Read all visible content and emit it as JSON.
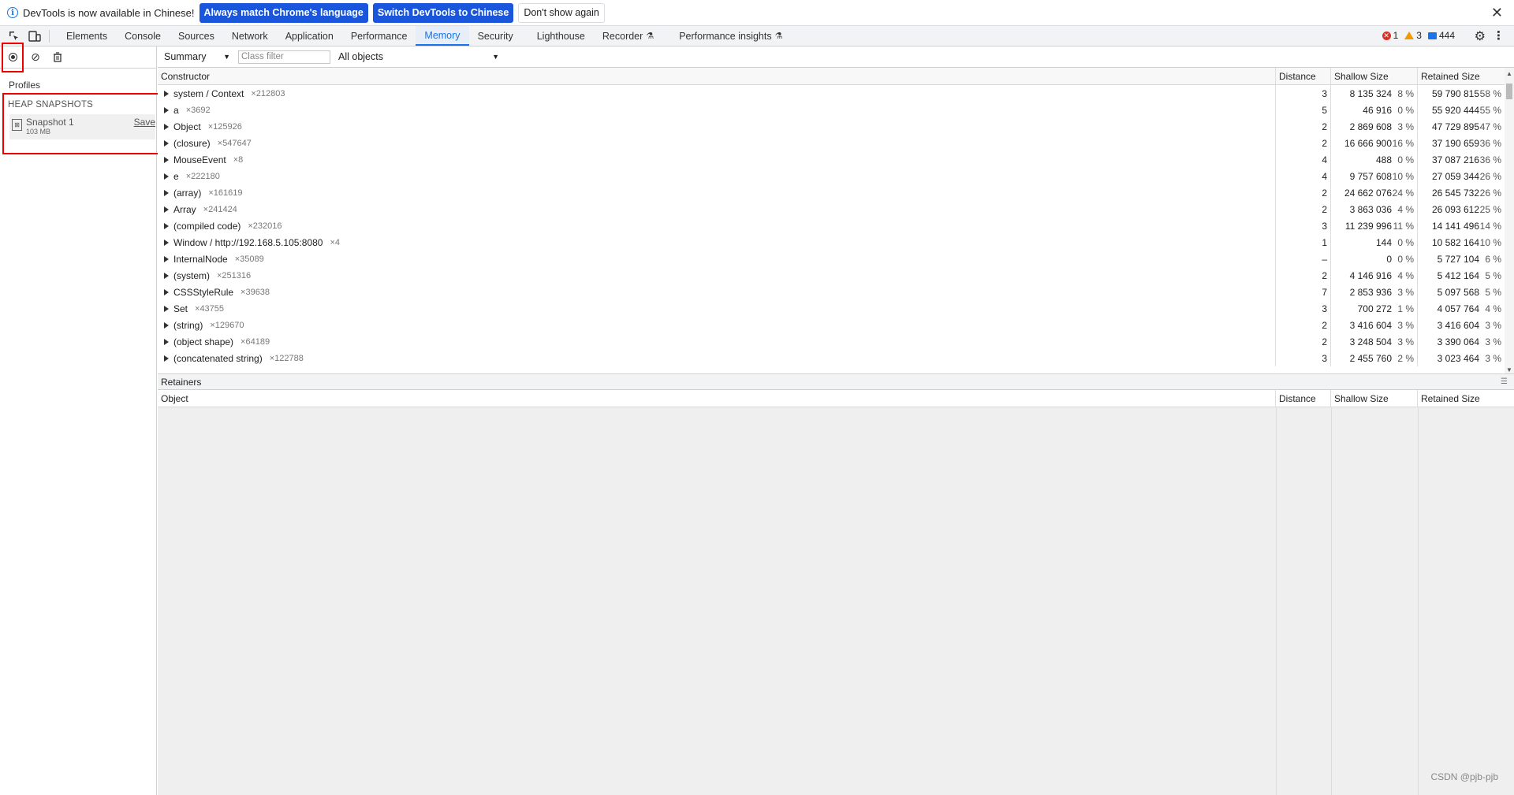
{
  "infobar": {
    "message": "DevTools is now available in Chinese!",
    "btn_match": "Always match Chrome's language",
    "btn_switch": "Switch DevTools to Chinese",
    "btn_dont_show": "Don't show again"
  },
  "tabs": {
    "elements": "Elements",
    "console": "Console",
    "sources": "Sources",
    "network": "Network",
    "application": "Application",
    "performance": "Performance",
    "memory": "Memory",
    "security": "Security",
    "lighthouse": "Lighthouse",
    "recorder": "Recorder",
    "perf_insights": "Performance insights"
  },
  "status": {
    "errors": "1",
    "warnings": "3",
    "messages": "444"
  },
  "sidebar": {
    "profiles_label": "Profiles",
    "heap_header": "HEAP SNAPSHOTS",
    "snapshot_name": "Snapshot 1",
    "snapshot_size": "103 MB",
    "save_label": "Save"
  },
  "toolbar": {
    "view": "Summary",
    "class_filter_placeholder": "Class filter",
    "filter": "All objects"
  },
  "grid": {
    "headers": {
      "constructor": "Constructor",
      "distance": "Distance",
      "shallow": "Shallow Size",
      "retained": "Retained Size"
    },
    "rows": [
      {
        "name": "system / Context",
        "count": "×212803",
        "distance": "3",
        "shallow": "8 135 324",
        "shallow_pct": "8 %",
        "retained": "59 790 815",
        "retained_pct": "58 %"
      },
      {
        "name": "a",
        "count": "×3692",
        "distance": "5",
        "shallow": "46 916",
        "shallow_pct": "0 %",
        "retained": "55 920 444",
        "retained_pct": "55 %"
      },
      {
        "name": "Object",
        "count": "×125926",
        "distance": "2",
        "shallow": "2 869 608",
        "shallow_pct": "3 %",
        "retained": "47 729 895",
        "retained_pct": "47 %"
      },
      {
        "name": "(closure)",
        "count": "×547647",
        "distance": "2",
        "shallow": "16 666 900",
        "shallow_pct": "16 %",
        "retained": "37 190 659",
        "retained_pct": "36 %"
      },
      {
        "name": "MouseEvent",
        "count": "×8",
        "distance": "4",
        "shallow": "488",
        "shallow_pct": "0 %",
        "retained": "37 087 216",
        "retained_pct": "36 %"
      },
      {
        "name": "e",
        "count": "×222180",
        "distance": "4",
        "shallow": "9 757 608",
        "shallow_pct": "10 %",
        "retained": "27 059 344",
        "retained_pct": "26 %"
      },
      {
        "name": "(array)",
        "count": "×161619",
        "distance": "2",
        "shallow": "24 662 076",
        "shallow_pct": "24 %",
        "retained": "26 545 732",
        "retained_pct": "26 %"
      },
      {
        "name": "Array",
        "count": "×241424",
        "distance": "2",
        "shallow": "3 863 036",
        "shallow_pct": "4 %",
        "retained": "26 093 612",
        "retained_pct": "25 %"
      },
      {
        "name": "(compiled code)",
        "count": "×232016",
        "distance": "3",
        "shallow": "11 239 996",
        "shallow_pct": "11 %",
        "retained": "14 141 496",
        "retained_pct": "14 %"
      },
      {
        "name": "Window / http://192.168.5.105:8080",
        "count": "×4",
        "distance": "1",
        "shallow": "144",
        "shallow_pct": "0 %",
        "retained": "10 582 164",
        "retained_pct": "10 %"
      },
      {
        "name": "InternalNode",
        "count": "×35089",
        "distance": "–",
        "shallow": "0",
        "shallow_pct": "0 %",
        "retained": "5 727 104",
        "retained_pct": "6 %"
      },
      {
        "name": "(system)",
        "count": "×251316",
        "distance": "2",
        "shallow": "4 146 916",
        "shallow_pct": "4 %",
        "retained": "5 412 164",
        "retained_pct": "5 %"
      },
      {
        "name": "CSSStyleRule",
        "count": "×39638",
        "distance": "7",
        "shallow": "2 853 936",
        "shallow_pct": "3 %",
        "retained": "5 097 568",
        "retained_pct": "5 %"
      },
      {
        "name": "Set",
        "count": "×43755",
        "distance": "3",
        "shallow": "700 272",
        "shallow_pct": "1 %",
        "retained": "4 057 764",
        "retained_pct": "4 %"
      },
      {
        "name": "(string)",
        "count": "×129670",
        "distance": "2",
        "shallow": "3 416 604",
        "shallow_pct": "3 %",
        "retained": "3 416 604",
        "retained_pct": "3 %"
      },
      {
        "name": "(object shape)",
        "count": "×64189",
        "distance": "2",
        "shallow": "3 248 504",
        "shallow_pct": "3 %",
        "retained": "3 390 064",
        "retained_pct": "3 %"
      },
      {
        "name": "(concatenated string)",
        "count": "×122788",
        "distance": "3",
        "shallow": "2 455 760",
        "shallow_pct": "2 %",
        "retained": "3 023 464",
        "retained_pct": "3 %"
      }
    ]
  },
  "retainers": {
    "title": "Retainers",
    "headers": {
      "object": "Object",
      "distance": "Distance",
      "shallow": "Shallow Size",
      "retained": "Retained Size"
    }
  },
  "watermark": "CSDN @pjb-pjb"
}
